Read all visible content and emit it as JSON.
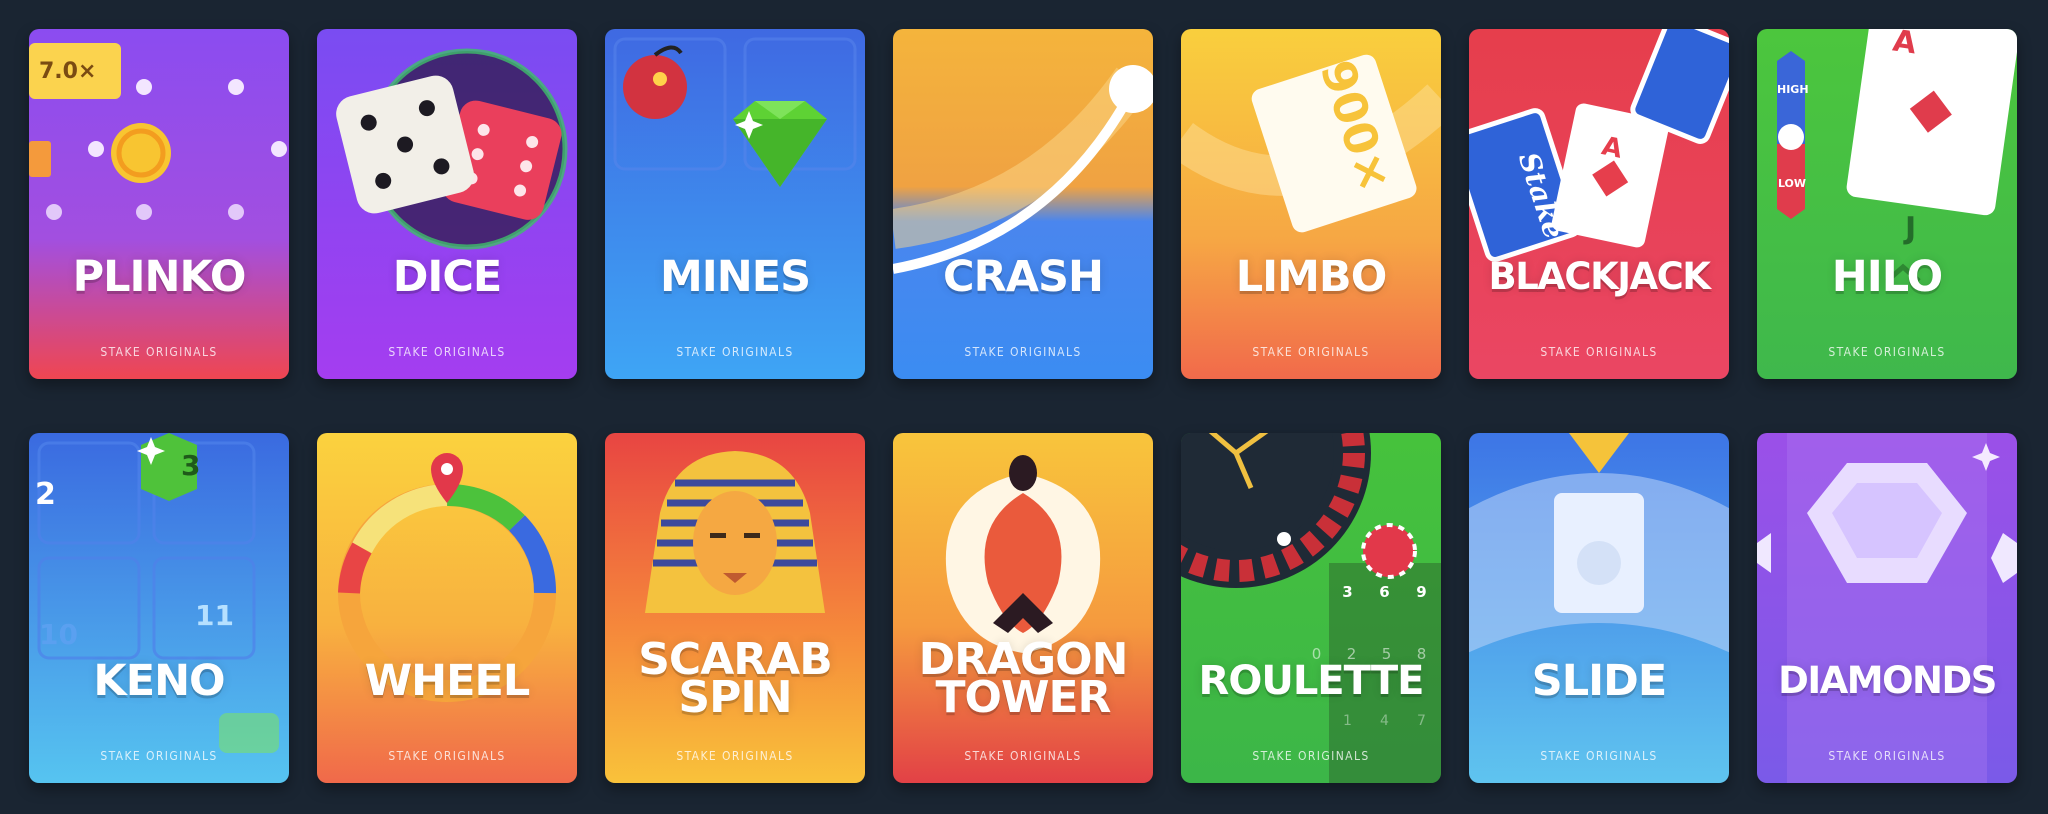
{
  "section": {
    "games": [
      {
        "title": "PLINKO",
        "subtitle": "STAKE ORIGINALS",
        "icon": "plinko-icon",
        "badge": "7.0×",
        "colors": {
          "top": "#8b4cf0",
          "bottom": "#ef4651"
        }
      },
      {
        "title": "DICE",
        "subtitle": "STAKE ORIGINALS",
        "icon": "dice-icon",
        "colors": {
          "top": "#7a4cf2",
          "bottom": "#a43df0"
        }
      },
      {
        "title": "MINES",
        "subtitle": "STAKE ORIGINALS",
        "icon": "gem-icon",
        "colors": {
          "top": "#3f69e2",
          "bottom": "#3ea5f5"
        }
      },
      {
        "title": "CRASH",
        "subtitle": "STAKE ORIGINALS",
        "icon": "rocket-curve-icon",
        "colors": {
          "top": "#f4a83a",
          "bottom": "#3b8cf2"
        }
      },
      {
        "title": "LIMBO",
        "subtitle": "STAKE ORIGINALS",
        "icon": "multiplier-card-icon",
        "card_text": "900×",
        "colors": {
          "top": "#f9cf3d",
          "bottom": "#f16a4b"
        }
      },
      {
        "title": "BLACKJACK",
        "subtitle": "STAKE ORIGINALS",
        "icon": "playing-cards-icon",
        "card_rank": "A",
        "card_brand": "Stake",
        "colors": {
          "top": "#e63e4c",
          "bottom": "#ea4663"
        }
      },
      {
        "title": "HILO",
        "subtitle": "STAKE ORIGINALS",
        "icon": "hilo-card-icon",
        "high_label": "HIGH",
        "low_label": "LOW",
        "card_rank": "A",
        "next_rank": "J",
        "colors": {
          "top": "#4cc63d",
          "bottom": "#3fb84c"
        }
      },
      {
        "title": "KENO",
        "subtitle": "STAKE ORIGINALS",
        "icon": "keno-tile-icon",
        "numbers": [
          "2",
          "3",
          "10",
          "11"
        ],
        "colors": {
          "top": "#3a6ae0",
          "bottom": "#56c4f0"
        }
      },
      {
        "title": "WHEEL",
        "subtitle": "STAKE ORIGINALS",
        "icon": "wheel-icon",
        "colors": {
          "top": "#fbd23e",
          "bottom": "#f0694a"
        }
      },
      {
        "title": "SCARAB SPIN",
        "subtitle": "STAKE ORIGINALS",
        "icon": "pharaoh-icon",
        "colors": {
          "top": "#e84542",
          "bottom": "#f9c23a"
        }
      },
      {
        "title": "DRAGON TOWER",
        "subtitle": "STAKE ORIGINALS",
        "icon": "dragon-egg-icon",
        "colors": {
          "top": "#f8c53c",
          "bottom": "#e24146"
        }
      },
      {
        "title": "ROULETTE",
        "subtitle": "STAKE ORIGINALS",
        "icon": "roulette-wheel-icon",
        "table_numbers": [
          "3",
          "6",
          "9",
          "0",
          "2",
          "5",
          "8",
          "1",
          "4",
          "7"
        ],
        "colors": {
          "top": "#46c23c",
          "bottom": "#3cb648"
        }
      },
      {
        "title": "SLIDE",
        "subtitle": "STAKE ORIGINALS",
        "icon": "slide-card-icon",
        "colors": {
          "top": "#3d75e6",
          "bottom": "#5fc4ef"
        }
      },
      {
        "title": "DIAMONDS",
        "subtitle": "STAKE ORIGINALS",
        "icon": "diamond-icon",
        "colors": {
          "top": "#9b50e8",
          "bottom": "#7a5ae8"
        }
      }
    ]
  },
  "theme": {
    "page_background": "#1a2532",
    "title_color": "#ffffff"
  }
}
